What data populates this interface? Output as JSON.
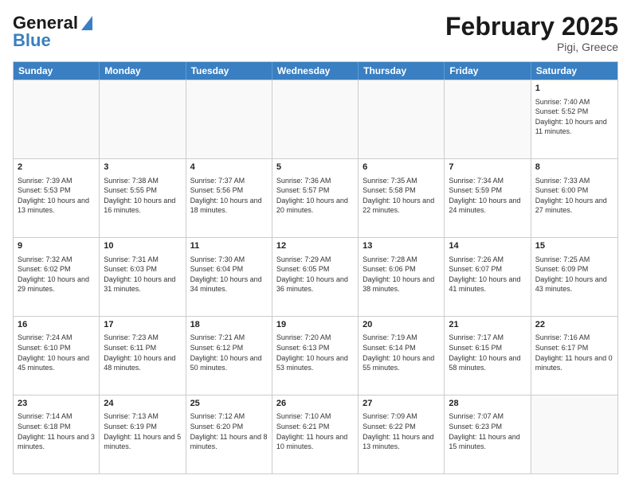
{
  "header": {
    "logo_general": "General",
    "logo_blue": "Blue",
    "month_title": "February 2025",
    "location": "Pigi, Greece"
  },
  "weekdays": [
    "Sunday",
    "Monday",
    "Tuesday",
    "Wednesday",
    "Thursday",
    "Friday",
    "Saturday"
  ],
  "rows": [
    [
      {
        "day": "",
        "text": ""
      },
      {
        "day": "",
        "text": ""
      },
      {
        "day": "",
        "text": ""
      },
      {
        "day": "",
        "text": ""
      },
      {
        "day": "",
        "text": ""
      },
      {
        "day": "",
        "text": ""
      },
      {
        "day": "1",
        "text": "Sunrise: 7:40 AM\nSunset: 5:52 PM\nDaylight: 10 hours and 11 minutes."
      }
    ],
    [
      {
        "day": "2",
        "text": "Sunrise: 7:39 AM\nSunset: 5:53 PM\nDaylight: 10 hours and 13 minutes."
      },
      {
        "day": "3",
        "text": "Sunrise: 7:38 AM\nSunset: 5:55 PM\nDaylight: 10 hours and 16 minutes."
      },
      {
        "day": "4",
        "text": "Sunrise: 7:37 AM\nSunset: 5:56 PM\nDaylight: 10 hours and 18 minutes."
      },
      {
        "day": "5",
        "text": "Sunrise: 7:36 AM\nSunset: 5:57 PM\nDaylight: 10 hours and 20 minutes."
      },
      {
        "day": "6",
        "text": "Sunrise: 7:35 AM\nSunset: 5:58 PM\nDaylight: 10 hours and 22 minutes."
      },
      {
        "day": "7",
        "text": "Sunrise: 7:34 AM\nSunset: 5:59 PM\nDaylight: 10 hours and 24 minutes."
      },
      {
        "day": "8",
        "text": "Sunrise: 7:33 AM\nSunset: 6:00 PM\nDaylight: 10 hours and 27 minutes."
      }
    ],
    [
      {
        "day": "9",
        "text": "Sunrise: 7:32 AM\nSunset: 6:02 PM\nDaylight: 10 hours and 29 minutes."
      },
      {
        "day": "10",
        "text": "Sunrise: 7:31 AM\nSunset: 6:03 PM\nDaylight: 10 hours and 31 minutes."
      },
      {
        "day": "11",
        "text": "Sunrise: 7:30 AM\nSunset: 6:04 PM\nDaylight: 10 hours and 34 minutes."
      },
      {
        "day": "12",
        "text": "Sunrise: 7:29 AM\nSunset: 6:05 PM\nDaylight: 10 hours and 36 minutes."
      },
      {
        "day": "13",
        "text": "Sunrise: 7:28 AM\nSunset: 6:06 PM\nDaylight: 10 hours and 38 minutes."
      },
      {
        "day": "14",
        "text": "Sunrise: 7:26 AM\nSunset: 6:07 PM\nDaylight: 10 hours and 41 minutes."
      },
      {
        "day": "15",
        "text": "Sunrise: 7:25 AM\nSunset: 6:09 PM\nDaylight: 10 hours and 43 minutes."
      }
    ],
    [
      {
        "day": "16",
        "text": "Sunrise: 7:24 AM\nSunset: 6:10 PM\nDaylight: 10 hours and 45 minutes."
      },
      {
        "day": "17",
        "text": "Sunrise: 7:23 AM\nSunset: 6:11 PM\nDaylight: 10 hours and 48 minutes."
      },
      {
        "day": "18",
        "text": "Sunrise: 7:21 AM\nSunset: 6:12 PM\nDaylight: 10 hours and 50 minutes."
      },
      {
        "day": "19",
        "text": "Sunrise: 7:20 AM\nSunset: 6:13 PM\nDaylight: 10 hours and 53 minutes."
      },
      {
        "day": "20",
        "text": "Sunrise: 7:19 AM\nSunset: 6:14 PM\nDaylight: 10 hours and 55 minutes."
      },
      {
        "day": "21",
        "text": "Sunrise: 7:17 AM\nSunset: 6:15 PM\nDaylight: 10 hours and 58 minutes."
      },
      {
        "day": "22",
        "text": "Sunrise: 7:16 AM\nSunset: 6:17 PM\nDaylight: 11 hours and 0 minutes."
      }
    ],
    [
      {
        "day": "23",
        "text": "Sunrise: 7:14 AM\nSunset: 6:18 PM\nDaylight: 11 hours and 3 minutes."
      },
      {
        "day": "24",
        "text": "Sunrise: 7:13 AM\nSunset: 6:19 PM\nDaylight: 11 hours and 5 minutes."
      },
      {
        "day": "25",
        "text": "Sunrise: 7:12 AM\nSunset: 6:20 PM\nDaylight: 11 hours and 8 minutes."
      },
      {
        "day": "26",
        "text": "Sunrise: 7:10 AM\nSunset: 6:21 PM\nDaylight: 11 hours and 10 minutes."
      },
      {
        "day": "27",
        "text": "Sunrise: 7:09 AM\nSunset: 6:22 PM\nDaylight: 11 hours and 13 minutes."
      },
      {
        "day": "28",
        "text": "Sunrise: 7:07 AM\nSunset: 6:23 PM\nDaylight: 11 hours and 15 minutes."
      },
      {
        "day": "",
        "text": ""
      }
    ]
  ]
}
